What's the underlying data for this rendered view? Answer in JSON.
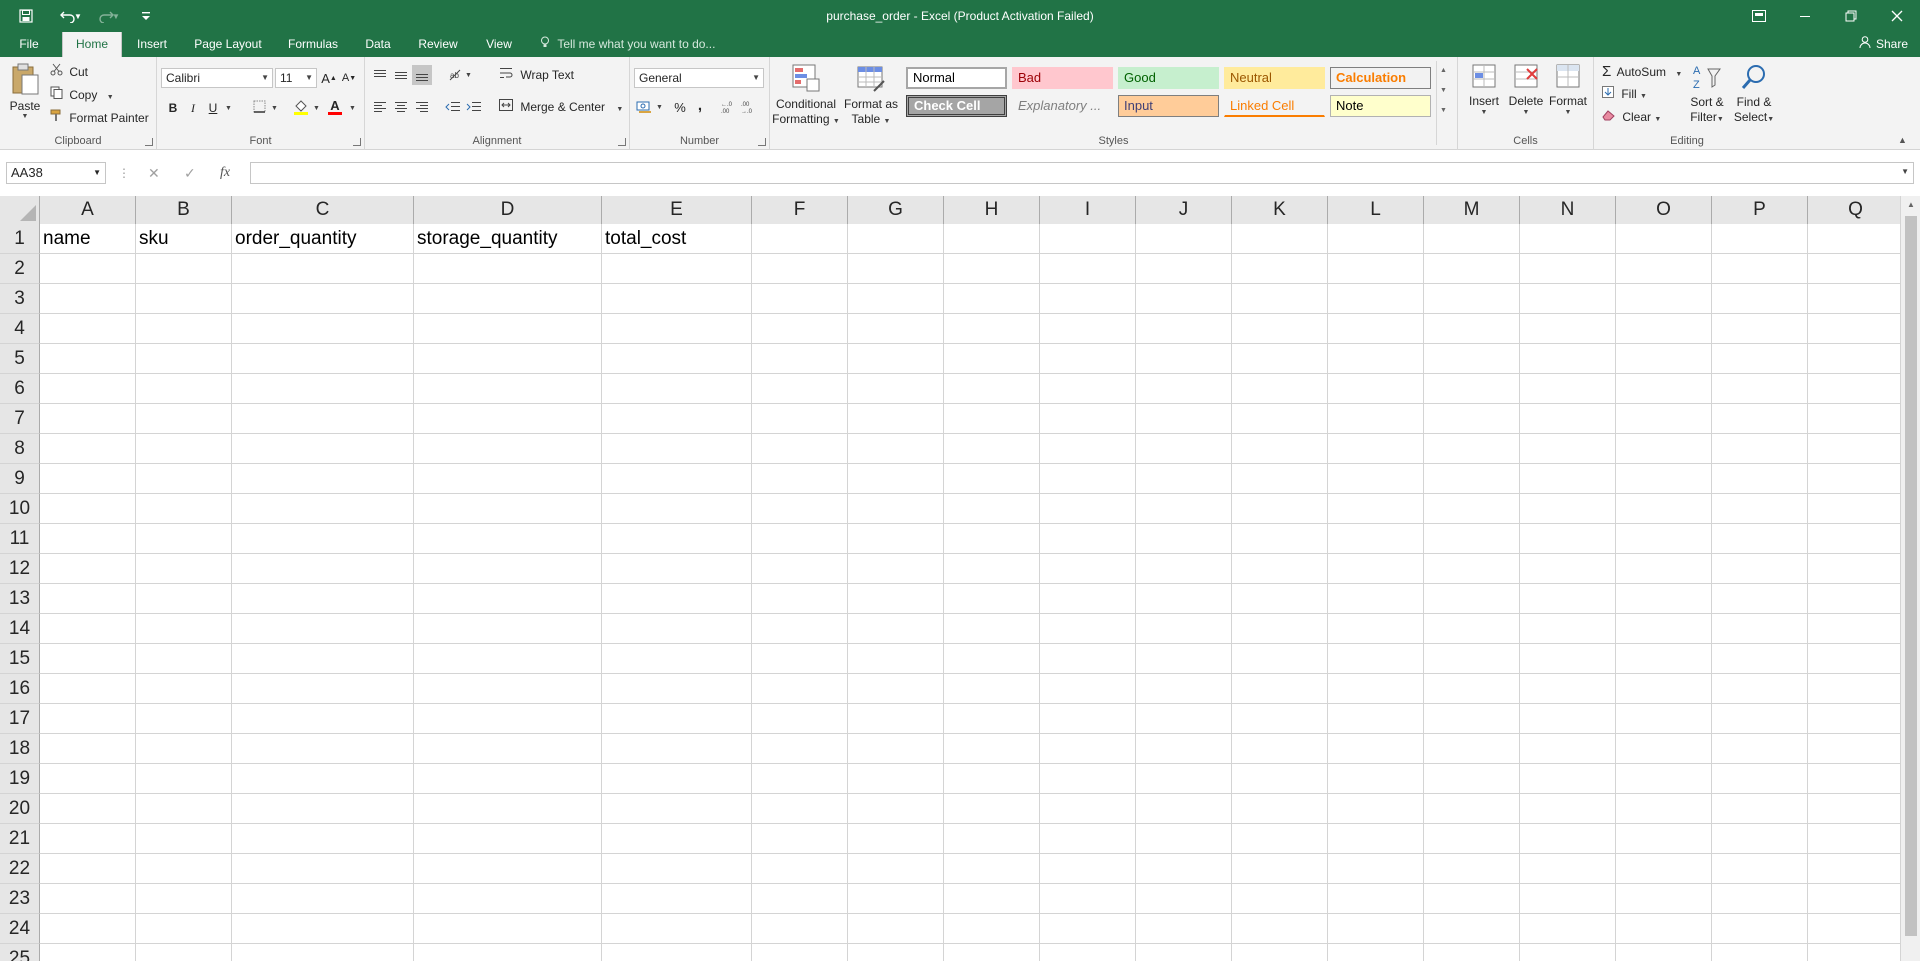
{
  "titlebar": {
    "title": "purchase_order - Excel (Product Activation Failed)",
    "qat": {
      "save_icon": "save-icon",
      "undo_icon": "undo-icon",
      "redo_icon": "redo-icon",
      "customize_icon": "customize-qat-icon"
    },
    "window_controls": [
      "ribbon-display-icon",
      "minimize-icon",
      "restore-icon",
      "close-icon"
    ]
  },
  "tabs": [
    {
      "label": "File"
    },
    {
      "label": "Home"
    },
    {
      "label": "Insert"
    },
    {
      "label": "Page Layout"
    },
    {
      "label": "Formulas"
    },
    {
      "label": "Data"
    },
    {
      "label": "Review"
    },
    {
      "label": "View"
    }
  ],
  "active_tab": "Home",
  "tell_me": "Tell me what you want to do...",
  "share": "Share",
  "ribbon": {
    "clipboard": {
      "label": "Clipboard",
      "paste": "Paste",
      "cut": "Cut",
      "copy": "Copy",
      "format_painter": "Format Painter"
    },
    "font": {
      "label": "Font",
      "font_name": "Calibri",
      "font_size": "11",
      "bold": "B",
      "italic": "I",
      "underline": "U",
      "grow": "A",
      "shrink": "A",
      "font_color": "A"
    },
    "alignment": {
      "label": "Alignment",
      "wrap_text": "Wrap Text",
      "merge_center": "Merge & Center"
    },
    "number": {
      "label": "Number",
      "format": "General",
      "percent": "%",
      "comma": ","
    },
    "styles": {
      "label": "Styles",
      "conditional_formatting": [
        "Conditional",
        "Formatting"
      ],
      "format_as_table": [
        "Format as",
        "Table"
      ],
      "cells": [
        {
          "name": "Normal",
          "bg": "#ffffff",
          "color": "#000000",
          "border": "#a6a6a6"
        },
        {
          "name": "Bad",
          "bg": "#ffc7ce",
          "color": "#9c0006",
          "border": "#ffc7ce"
        },
        {
          "name": "Good",
          "bg": "#c6efce",
          "color": "#006100",
          "border": "#c6efce"
        },
        {
          "name": "Neutral",
          "bg": "#ffeb9c",
          "color": "#9c5700",
          "border": "#ffeb9c"
        },
        {
          "name": "Calculation",
          "bg": "#f2f2f2",
          "color": "#fa7d00",
          "border": "#7f7f7f"
        },
        {
          "name": "Check Cell",
          "bg": "#a5a5a5",
          "color": "#ffffff",
          "border": "#3f3f3f"
        },
        {
          "name": "Explanatory ...",
          "bg": "#f3f3f3",
          "color": "#7f7f7f",
          "border": "#f3f3f3"
        },
        {
          "name": "Input",
          "bg": "#ffcc99",
          "color": "#3f3f76",
          "border": "#7f7f7f"
        },
        {
          "name": "Linked Cell",
          "bg": "#f3f3f3",
          "color": "#fa7d00",
          "border": "#f3f3f3"
        },
        {
          "name": "Note",
          "bg": "#ffffcc",
          "color": "#000000",
          "border": "#b2b2b2"
        }
      ]
    },
    "cells": {
      "label": "Cells",
      "insert": "Insert",
      "delete": "Delete",
      "format": "Format"
    },
    "editing": {
      "label": "Editing",
      "autosum": "AutoSum",
      "fill": "Fill",
      "clear": "Clear",
      "sort_filter": [
        "Sort &",
        "Filter"
      ],
      "find_select": [
        "Find &",
        "Select"
      ]
    }
  },
  "formula_bar": {
    "name_box": "AA38",
    "fx": "fx",
    "value": ""
  },
  "sheet": {
    "columns": [
      "A",
      "B",
      "C",
      "D",
      "E",
      "F",
      "G",
      "H",
      "I",
      "J",
      "K",
      "L",
      "M",
      "N",
      "O",
      "P",
      "Q"
    ],
    "rows": [
      "1",
      "2",
      "3",
      "4",
      "5",
      "6",
      "7",
      "8",
      "9",
      "10",
      "11",
      "12",
      "13",
      "14",
      "15",
      "16",
      "17",
      "18",
      "19",
      "20",
      "21",
      "22",
      "23",
      "24",
      "25"
    ],
    "header_row": [
      "name",
      "sku",
      "order_quantity",
      "storage_quantity",
      "total_cost"
    ]
  },
  "colors": {
    "accent": "#217346",
    "ribbon_bg": "#f3f3f3",
    "gridline": "#d4d4d4"
  }
}
